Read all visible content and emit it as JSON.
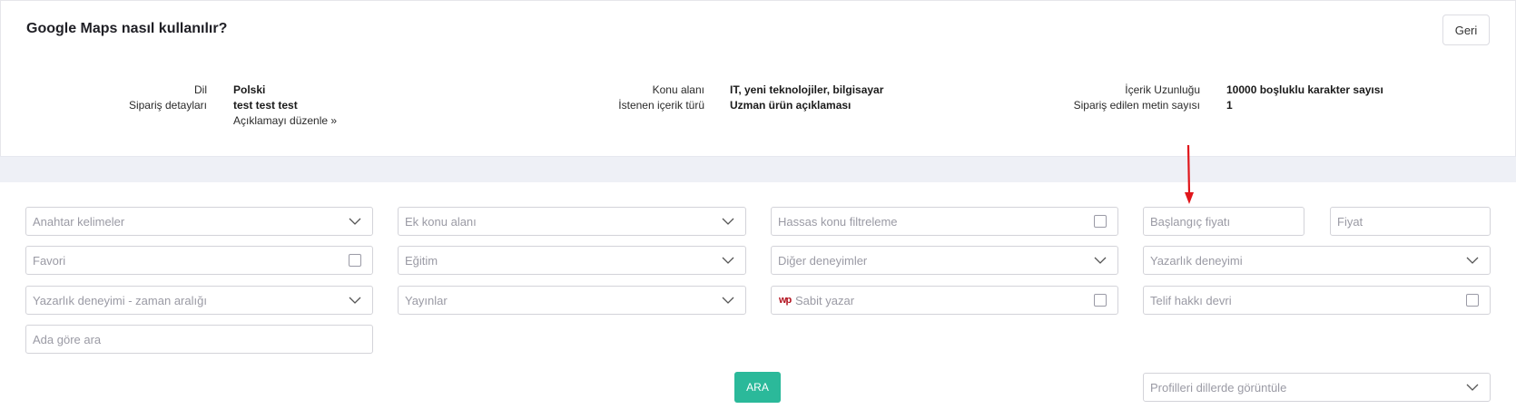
{
  "header": {
    "title": "Google Maps nasıl kullanılır?",
    "back_label": "Geri"
  },
  "details": {
    "col1": {
      "lang_label": "Dil",
      "lang_value": "Polski",
      "order_label": "Sipariş detayları",
      "order_value": "test test test",
      "edit_link": "Açıklamayı düzenle »"
    },
    "col2": {
      "topic_label": "Konu alanı",
      "topic_value": "IT, yeni teknolojiler, bilgisayar",
      "type_label": "İstenen içerik türü",
      "type_value": "Uzman ürün açıklaması"
    },
    "col3": {
      "length_label": "İçerik Uzunluğu",
      "length_value": "10000 boşluklu karakter sayısı",
      "count_label": "Sipariş edilen metin sayısı",
      "count_value": "1"
    }
  },
  "filters": {
    "keywords": "Anahtar kelimeler",
    "extra_topic": "Ek konu alanı",
    "sensitive_topic": "Hassas konu filtreleme",
    "price_start": "Başlangıç fiyatı",
    "price": "Fiyat",
    "favorite": "Favori",
    "education": "Eğitim",
    "other_experience": "Diğer deneyimler",
    "writing_experience": "Yazarlık deneyimi",
    "writing_period": "Yazarlık deneyimi - zaman aralığı",
    "publications": "Yayınlar",
    "fixed_writer": "Sabit yazar",
    "fixed_writer_logo": "wp",
    "copyright": "Telif hakkı devri",
    "name_search": "Ada göre ara",
    "profile_languages": "Profilleri dillerde görüntüle"
  },
  "actions": {
    "search_label": "ARA"
  },
  "colors": {
    "accent": "#2bb99a",
    "annotation_arrow": "#e0161b",
    "separator": "#eef0f6"
  }
}
